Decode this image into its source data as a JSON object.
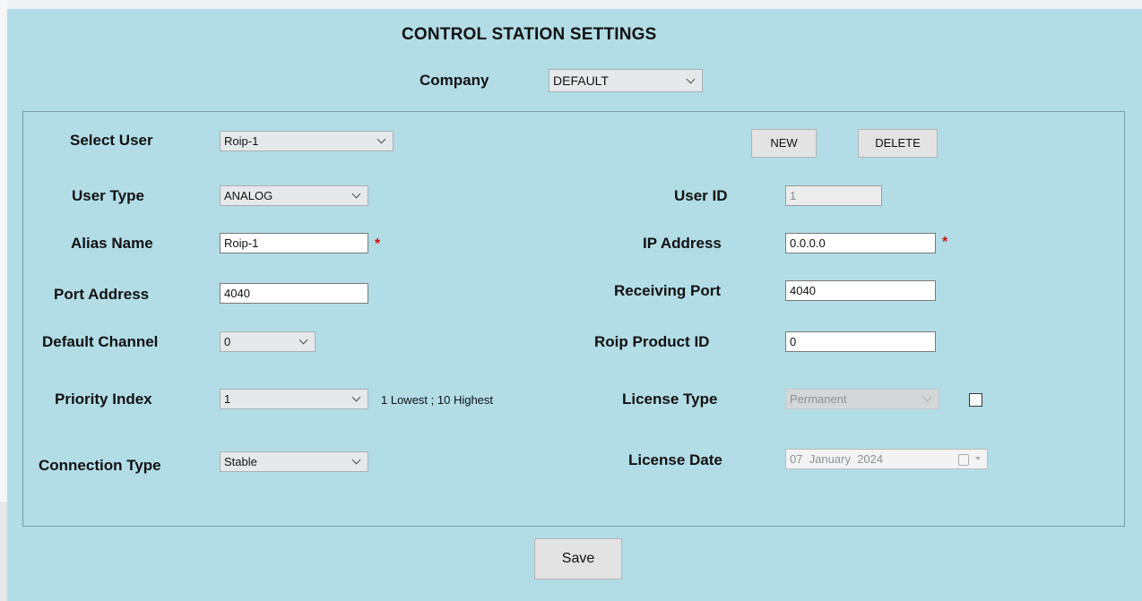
{
  "window": {
    "title": "CONTROL STATION SETTINGS",
    "company_label": "Company",
    "company_value": "DEFAULT"
  },
  "form": {
    "select_user": {
      "label": "Select User",
      "value": "Roip-1"
    },
    "new_button": "NEW",
    "delete_button": "DELETE",
    "user_type": {
      "label": "User Type",
      "value": "ANALOG"
    },
    "user_id": {
      "label": "User ID",
      "value": "1"
    },
    "alias_name": {
      "label": "Alias Name",
      "value": "Roip-1",
      "required_mark": "*"
    },
    "ip_address": {
      "label": "IP Address",
      "value": "0.0.0.0",
      "required_mark": "*"
    },
    "port_address": {
      "label": "Port Address",
      "value": "4040"
    },
    "receiving_port": {
      "label": "Receiving Port",
      "value": "4040"
    },
    "default_channel": {
      "label": "Default Channel",
      "value": "0"
    },
    "roip_product_id": {
      "label": "Roip Product ID",
      "value": "0"
    },
    "priority_index": {
      "label": "Priority Index",
      "value": "1",
      "hint": "1 Lowest ; 10 Highest"
    },
    "license_type": {
      "label": "License Type",
      "value": "Permanent",
      "checked": false
    },
    "connection_type": {
      "label": "Connection Type",
      "value": "Stable"
    },
    "license_date": {
      "label": "License Date",
      "day": "07",
      "month": "January",
      "year": "2024"
    }
  },
  "save_button": "Save",
  "icons": {
    "dropdown": "chevron-down-icon",
    "required": "asterisk",
    "date_picker": "calendar-icon"
  },
  "colors": {
    "window_bg": "#b2dde6",
    "required": "#d01010",
    "button_bg": "#e3e3e3"
  }
}
